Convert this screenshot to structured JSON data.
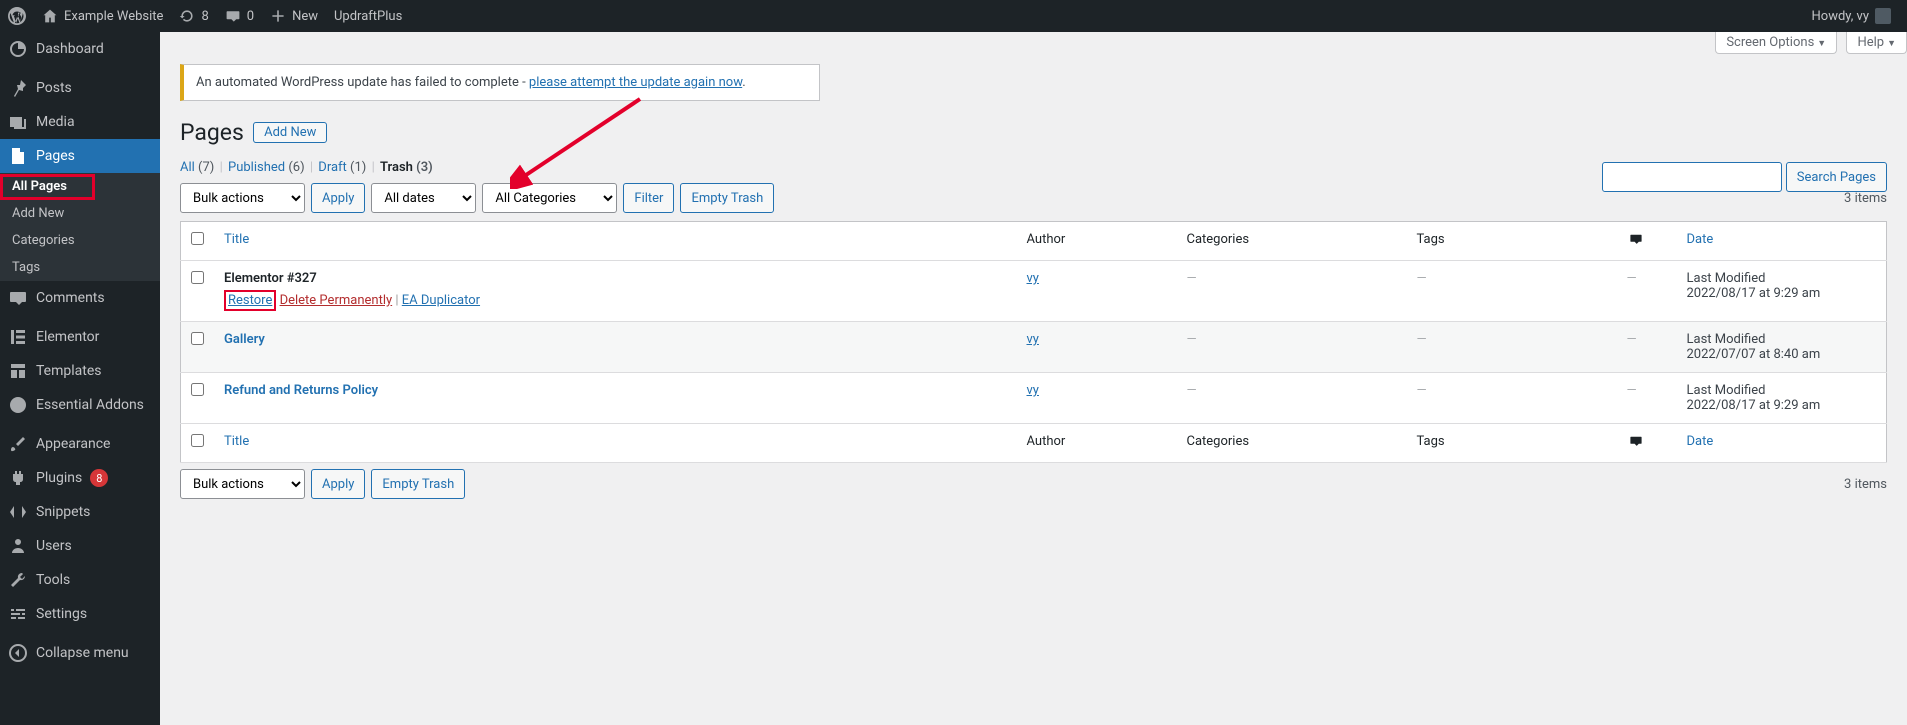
{
  "adminbar": {
    "site_name": "Example Website",
    "updates_count": "8",
    "comments_count": "0",
    "new_label": "New",
    "updraft": "UpdraftPlus",
    "howdy": "Howdy, vy"
  },
  "sidebar": {
    "dashboard": "Dashboard",
    "posts": "Posts",
    "media": "Media",
    "pages": "Pages",
    "sub_all_pages": "All Pages",
    "sub_add_new": "Add New",
    "sub_categories": "Categories",
    "sub_tags": "Tags",
    "comments": "Comments",
    "elementor": "Elementor",
    "templates": "Templates",
    "essential_addons": "Essential Addons",
    "appearance": "Appearance",
    "plugins": "Plugins",
    "plugins_badge": "8",
    "snippets": "Snippets",
    "users": "Users",
    "tools": "Tools",
    "settings": "Settings",
    "collapse": "Collapse menu"
  },
  "screen_meta": {
    "options": "Screen Options",
    "help": "Help"
  },
  "notice": {
    "text": "An automated WordPress update has failed to complete - ",
    "link": "please attempt the update again now",
    "text2": "."
  },
  "heading": "Pages",
  "add_new": "Add New",
  "filters": {
    "all": "All",
    "all_count": "(7)",
    "published": "Published",
    "published_count": "(6)",
    "draft": "Draft",
    "draft_count": "(1)",
    "trash": "Trash",
    "trash_count": "(3)"
  },
  "search_btn": "Search Pages",
  "tablenav": {
    "bulk": "Bulk actions",
    "apply": "Apply",
    "dates": "All dates",
    "cats": "All Categories",
    "filter": "Filter",
    "empty": "Empty Trash",
    "count_text": "3 items"
  },
  "columns": {
    "title": "Title",
    "author": "Author",
    "categories": "Categories",
    "tags": "Tags",
    "date": "Date"
  },
  "rows": [
    {
      "title": "Elementor #327",
      "author": "vy",
      "date_label": "Last Modified",
      "date": "2022/08/17 at 9:29 am",
      "actions": {
        "restore": "Restore",
        "del": "Delete Permanently",
        "ea": "EA Duplicator"
      }
    },
    {
      "title": "Gallery",
      "author": "vy",
      "date_label": "Last Modified",
      "date": "2022/07/07 at 8:40 am"
    },
    {
      "title": "Refund and Returns Policy",
      "author": "vy",
      "date_label": "Last Modified",
      "date": "2022/08/17 at 9:29 am"
    }
  ]
}
